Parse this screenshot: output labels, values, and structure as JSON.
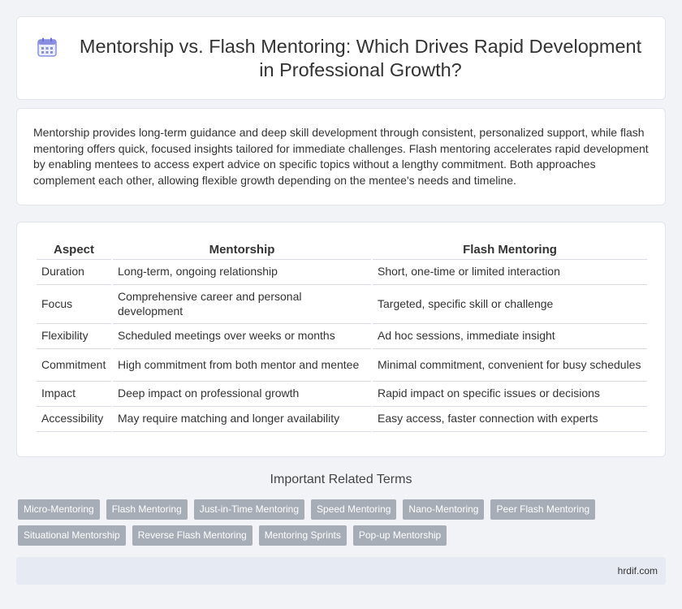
{
  "header": {
    "icon": "calendar-icon",
    "title": "Mentorship vs. Flash Mentoring: Which Drives Rapid Development in Professional Growth?"
  },
  "intro": {
    "text": "Mentorship provides long-term guidance and deep skill development through consistent, personalized support, while flash mentoring offers quick, focused insights tailored for immediate challenges. Flash mentoring accelerates rapid development by enabling mentees to access expert advice on specific topics without a lengthy commitment. Both approaches complement each other, allowing flexible growth depending on the mentee's needs and timeline."
  },
  "table": {
    "headers": [
      "Aspect",
      "Mentorship",
      "Flash Mentoring"
    ],
    "rows": [
      [
        "Duration",
        "Long-term, ongoing relationship",
        "Short, one-time or limited interaction"
      ],
      [
        "Focus",
        "Comprehensive career and personal development",
        "Targeted, specific skill or challenge"
      ],
      [
        "Flexibility",
        "Scheduled meetings over weeks or months",
        "Ad hoc sessions, immediate insight"
      ],
      [
        "Commitment",
        "High commitment from both mentor and mentee",
        "Minimal commitment, convenient for busy schedules"
      ],
      [
        "Impact",
        "Deep impact on professional growth",
        "Rapid impact on specific issues or decisions"
      ],
      [
        "Accessibility",
        "May require matching and longer availability",
        "Easy access, faster connection with experts"
      ]
    ]
  },
  "related": {
    "heading": "Important Related Terms",
    "tags": [
      "Micro-Mentoring",
      "Flash Mentoring",
      "Just-in-Time Mentoring",
      "Speed Mentoring",
      "Nano-Mentoring",
      "Peer Flash Mentoring",
      "Situational Mentorship",
      "Reverse Flash Mentoring",
      "Mentoring Sprints",
      "Pop-up Mentorship"
    ]
  },
  "footer": {
    "site": "hrdif.com"
  },
  "colors": {
    "background": "#f1f3f7",
    "card": "#ffffff",
    "tag": "#a6adb6",
    "footer_bar": "#e6eaf3",
    "icon_accent": "#7b7fd6"
  }
}
